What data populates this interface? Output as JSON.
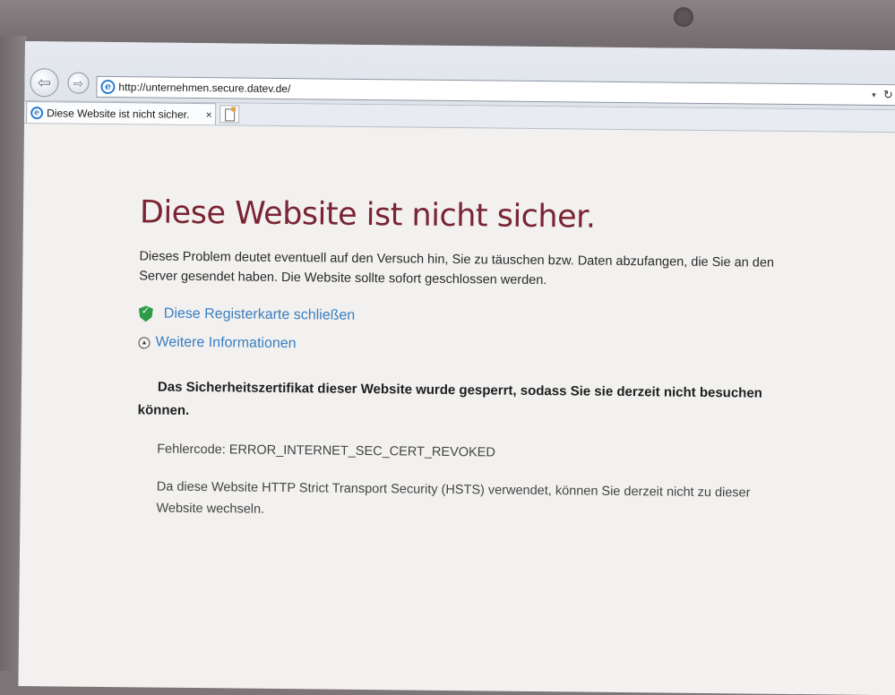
{
  "browser": {
    "url": "http://unternehmen.secure.datev.de/",
    "tab_title": "Diese Website ist nicht sicher.",
    "tab_close": "×",
    "back_symbol": "⇦",
    "forward_symbol": "⇨",
    "dropdown_symbol": "▾",
    "refresh_symbol": "↻",
    "ie_glyph": "e"
  },
  "page": {
    "title": "Diese Website ist nicht sicher.",
    "intro": "Dieses Problem deutet eventuell auf den Versuch hin, Sie zu täuschen bzw. Daten abzufangen, die Sie an den Server gesendet haben. Die Website sollte sofort geschlossen werden.",
    "close_tab_link": "Diese Registerkarte schließen",
    "more_info_link": "Weitere Informationen",
    "more_info_symbol": "▲",
    "warning": "Das Sicherheitszertifikat dieser Website wurde gesperrt, sodass Sie sie derzeit nicht besuchen können.",
    "error_code": "Fehlercode: ERROR_INTERNET_SEC_CERT_REVOKED",
    "hsts_note": "Da diese Website HTTP Strict Transport Security (HSTS) verwendet, können Sie derzeit nicht zu dieser Website wechseln."
  },
  "colors": {
    "title": "#7a2433",
    "link": "#3a7ec2",
    "shield": "#2f9b49"
  }
}
